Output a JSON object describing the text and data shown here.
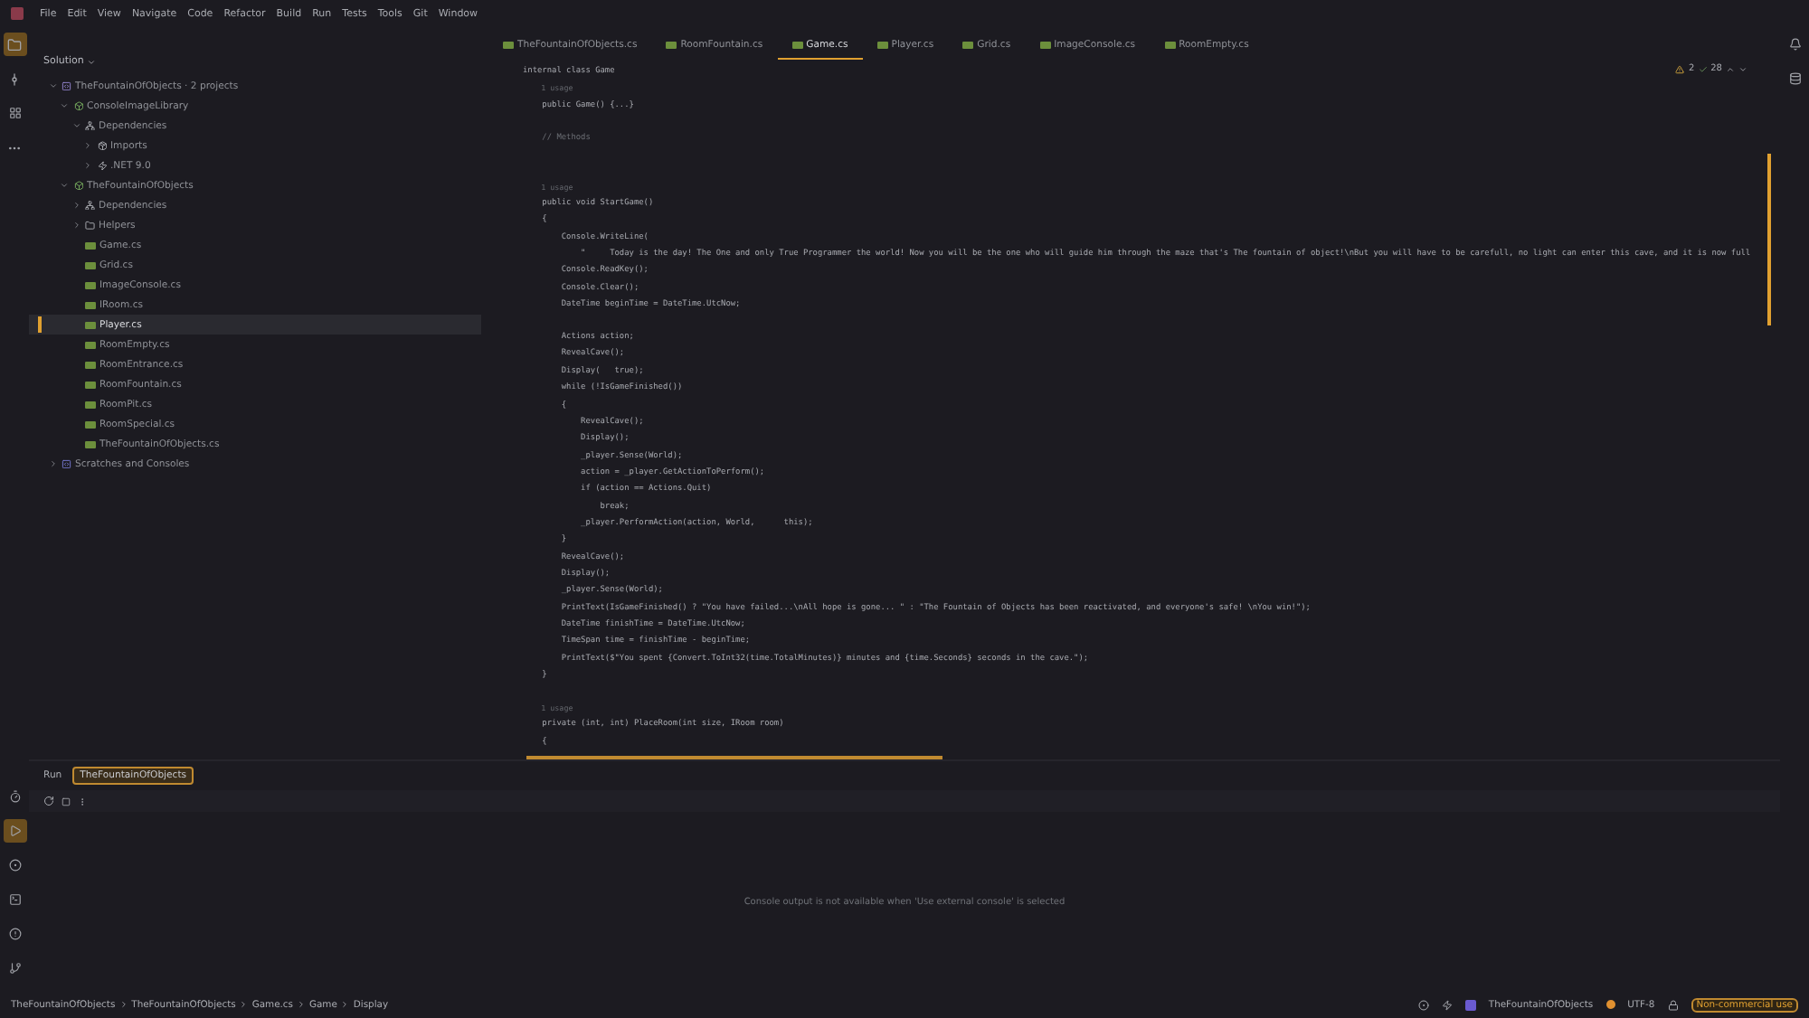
{
  "menu": [
    "File",
    "Edit",
    "View",
    "Navigate",
    "Code",
    "Refactor",
    "Build",
    "Run",
    "Tests",
    "Tools",
    "Git",
    "Window"
  ],
  "sidebar": {
    "title": "Solution",
    "tree": [
      {
        "label": "TheFountainOfObjects · 2 projects",
        "kind": "solution",
        "expanded": true,
        "selected": false,
        "children": [
          {
            "label": "ConsoleImageLibrary",
            "kind": "project",
            "expanded": true,
            "selected": false,
            "children": [
              {
                "label": "Dependencies",
                "kind": "deps",
                "expanded": true,
                "selected": false,
                "children": [
                  {
                    "label": "Imports",
                    "kind": "imports",
                    "expanded": false,
                    "selected": false
                  },
                  {
                    "label": ".NET 9.0",
                    "kind": "sdk",
                    "expanded": false,
                    "selected": false
                  }
                ]
              }
            ]
          },
          {
            "label": "TheFountainOfObjects",
            "kind": "project",
            "expanded": true,
            "selected": false,
            "children": [
              {
                "label": "Dependencies",
                "kind": "deps",
                "expanded": false,
                "selected": false
              },
              {
                "label": "Helpers",
                "kind": "folder",
                "expanded": false,
                "selected": false
              },
              {
                "label": "Game.cs",
                "kind": "file",
                "selected": false
              },
              {
                "label": "Grid.cs",
                "kind": "file",
                "selected": false
              },
              {
                "label": "ImageConsole.cs",
                "kind": "file",
                "selected": false
              },
              {
                "label": "IRoom.cs",
                "kind": "file",
                "selected": false
              },
              {
                "label": "Player.cs",
                "kind": "file",
                "selected": true
              },
              {
                "label": "RoomEmpty.cs",
                "kind": "file",
                "selected": false
              },
              {
                "label": "RoomEntrance.cs",
                "kind": "file",
                "selected": false
              },
              {
                "label": "RoomFountain.cs",
                "kind": "file",
                "selected": false
              },
              {
                "label": "RoomPit.cs",
                "kind": "file",
                "selected": false
              },
              {
                "label": "RoomSpecial.cs",
                "kind": "file",
                "selected": false
              },
              {
                "label": "TheFountainOfObjects.cs",
                "kind": "file",
                "selected": false
              }
            ]
          }
        ]
      },
      {
        "label": "Scratches and Consoles",
        "kind": "scratch",
        "expanded": false,
        "selected": false
      }
    ]
  },
  "tabs": [
    {
      "label": "TheFountainOfObjects.cs",
      "selected": false
    },
    {
      "label": "RoomFountain.cs",
      "selected": false
    },
    {
      "label": "Game.cs",
      "selected": true
    },
    {
      "label": "Player.cs",
      "selected": false
    },
    {
      "label": "Grid.cs",
      "selected": false
    },
    {
      "label": "ImageConsole.cs",
      "selected": false
    },
    {
      "label": "RoomEmpty.cs",
      "selected": false
    }
  ],
  "inspections": {
    "warnings": "2",
    "checks": "28"
  },
  "code": [
    {
      "kind": "code",
      "text": "internal class Game"
    },
    {
      "kind": "hint",
      "text": "    1 usage"
    },
    {
      "kind": "code",
      "text": "    public Game() {...}"
    },
    {
      "kind": "blank"
    },
    {
      "kind": "comment",
      "text": "    // Methods"
    },
    {
      "kind": "blank"
    },
    {
      "kind": "blank"
    },
    {
      "kind": "hint",
      "text": "    1 usage"
    },
    {
      "kind": "code",
      "text": "    public void StartGame()"
    },
    {
      "kind": "code",
      "text": "    {"
    },
    {
      "kind": "code",
      "text": "        Console.WriteLine("
    },
    {
      "kind": "code",
      "text": "            \"     Today is the day! The One and only True Programmer the world! Now you will be the one who will guide him through the maze that's The fountain of object!\\nBut you will have to be carefull, no light can enter this cave, and it is now full"
    },
    {
      "kind": "code",
      "text": "        Console.ReadKey();"
    },
    {
      "kind": "code",
      "text": "        Console.Clear();"
    },
    {
      "kind": "code",
      "text": "        DateTime beginTime = DateTime.UtcNow;"
    },
    {
      "kind": "blank"
    },
    {
      "kind": "code",
      "text": "        Actions action;"
    },
    {
      "kind": "code",
      "text": "        RevealCave();"
    },
    {
      "kind": "code",
      "text": "        Display(   true);"
    },
    {
      "kind": "code",
      "text": "        while (!IsGameFinished())"
    },
    {
      "kind": "code",
      "text": "        {"
    },
    {
      "kind": "code",
      "text": "            RevealCave();"
    },
    {
      "kind": "code",
      "text": "            Display();"
    },
    {
      "kind": "code",
      "text": "            _player.Sense(World);"
    },
    {
      "kind": "code",
      "text": "            action = _player.GetActionToPerform();"
    },
    {
      "kind": "code",
      "text": "            if (action == Actions.Quit)"
    },
    {
      "kind": "code",
      "text": "                break;"
    },
    {
      "kind": "code",
      "text": "            _player.PerformAction(action, World,      this);"
    },
    {
      "kind": "code",
      "text": "        }"
    },
    {
      "kind": "code",
      "text": "        RevealCave();"
    },
    {
      "kind": "code",
      "text": "        Display();"
    },
    {
      "kind": "code",
      "text": "        _player.Sense(World);"
    },
    {
      "kind": "code",
      "text": "        PrintText(IsGameFinished() ? \"You have failed...\\nAll hope is gone... \" : \"The Fountain of Objects has been reactivated, and everyone's safe! \\nYou win!\");"
    },
    {
      "kind": "code",
      "text": "        DateTime finishTime = DateTime.UtcNow;"
    },
    {
      "kind": "code",
      "text": "        TimeSpan time = finishTime - beginTime;"
    },
    {
      "kind": "code",
      "text": "        PrintText($\"You spent {Convert.ToInt32(time.TotalMinutes)} minutes and {time.Seconds} seconds in the cave.\");"
    },
    {
      "kind": "code",
      "text": "    }"
    },
    {
      "kind": "blank"
    },
    {
      "kind": "hint",
      "text": "    1 usage"
    },
    {
      "kind": "code",
      "text": "    private (int, int) PlaceRoom(int size, IRoom room)"
    },
    {
      "kind": "code",
      "text": "    {"
    }
  ],
  "run": {
    "title": "Run",
    "tabs": [
      {
        "label": "TheFountainOfObjects",
        "selected": true
      }
    ],
    "message": "Console output is not available when 'Use external console' is selected"
  },
  "status": {
    "breadcrumbs": [
      "TheFountainOfObjects",
      "TheFountainOfObjects",
      "Game.cs",
      "Game",
      "Display"
    ],
    "project": "TheFountainOfObjects",
    "encoding": "UTF-8",
    "license": "Non-commercial use"
  }
}
